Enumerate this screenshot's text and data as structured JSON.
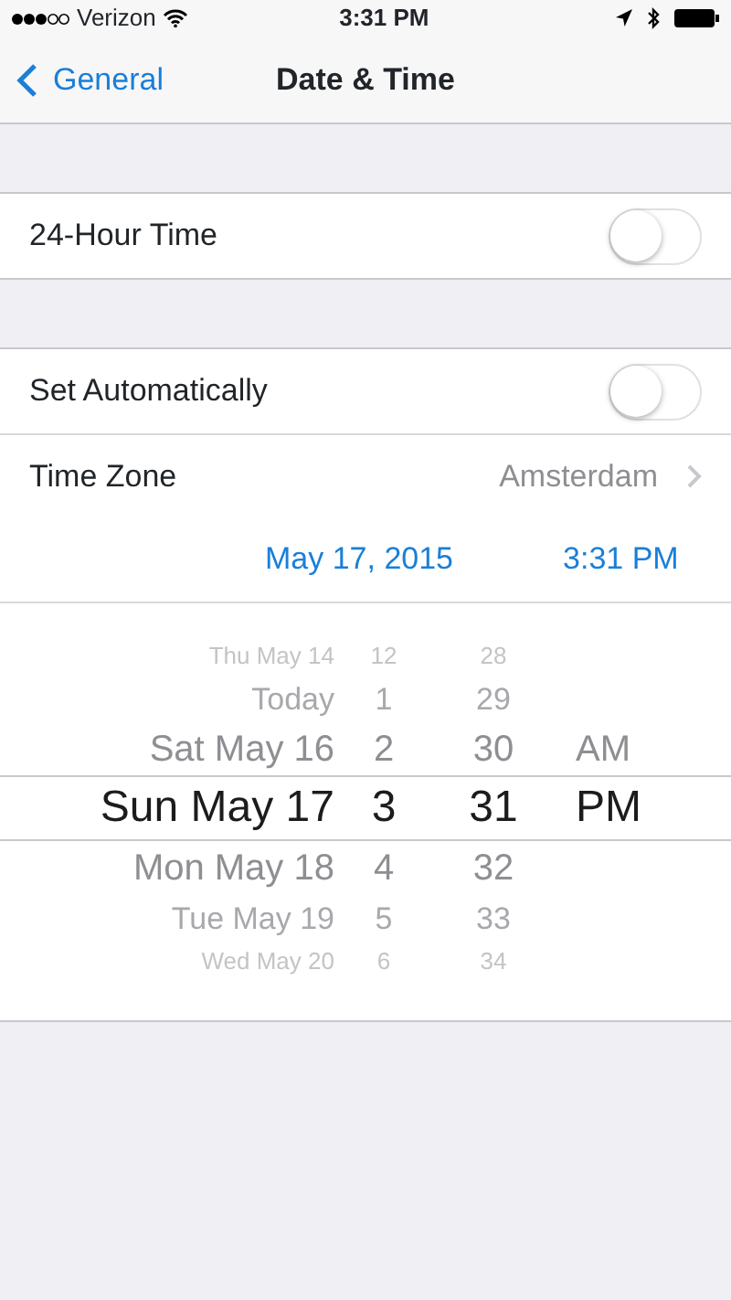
{
  "status_bar": {
    "carrier": "Verizon",
    "time": "3:31 PM"
  },
  "nav": {
    "back": "General",
    "title": "Date & Time"
  },
  "groups": [
    {
      "rows": [
        {
          "kind": "toggle",
          "label": "24-Hour Time",
          "on": false
        }
      ]
    },
    {
      "rows": [
        {
          "kind": "toggle",
          "label": "Set Automatically",
          "on": false
        },
        {
          "kind": "link",
          "label": "Time Zone",
          "value": "Amsterdam"
        }
      ]
    }
  ],
  "date_time": {
    "date": "May 17, 2015",
    "time": "3:31 PM"
  },
  "picker": {
    "rows": [
      {
        "date": "Thu May 14",
        "hour": "12",
        "minute": "28",
        "period": "",
        "selected": false
      },
      {
        "date": "Today",
        "hour": "1",
        "minute": "29",
        "period": "",
        "selected": false
      },
      {
        "date": "Sat May 16",
        "hour": "2",
        "minute": "30",
        "period": "AM",
        "selected": false
      },
      {
        "date": "Sun May 17",
        "hour": "3",
        "minute": "31",
        "period": "PM",
        "selected": true
      },
      {
        "date": "Mon May 18",
        "hour": "4",
        "minute": "32",
        "period": "",
        "selected": false
      },
      {
        "date": "Tue May 19",
        "hour": "5",
        "minute": "33",
        "period": "",
        "selected": false
      },
      {
        "date": "Wed May 20",
        "hour": "6",
        "minute": "34",
        "period": "",
        "selected": false
      }
    ]
  }
}
